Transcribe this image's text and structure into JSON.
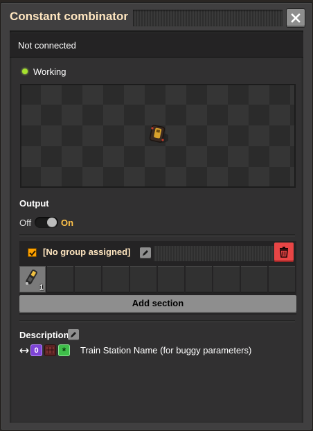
{
  "window": {
    "title": "Constant combinator"
  },
  "status": {
    "connection": "Not connected",
    "working": "Working"
  },
  "output": {
    "heading": "Output",
    "off_label": "Off",
    "on_label": "On",
    "enabled": true
  },
  "group": {
    "name": "[No group assigned]",
    "checked": true,
    "slots": [
      {
        "icon": "locomotive-icon",
        "count": "1"
      },
      {},
      {},
      {},
      {},
      {},
      {},
      {},
      {},
      {}
    ],
    "add_section_label": "Add section"
  },
  "description": {
    "heading": "Description",
    "signal_zero": "0",
    "signal_star": "*",
    "text": "Train Station Name (for buggy parameters)"
  },
  "colors": {
    "title": "#ffe6c0",
    "accent_on": "#ffc34a",
    "checkbox": "#ffa200",
    "delete": "#e84545",
    "status_dot": "#a6e22e"
  }
}
